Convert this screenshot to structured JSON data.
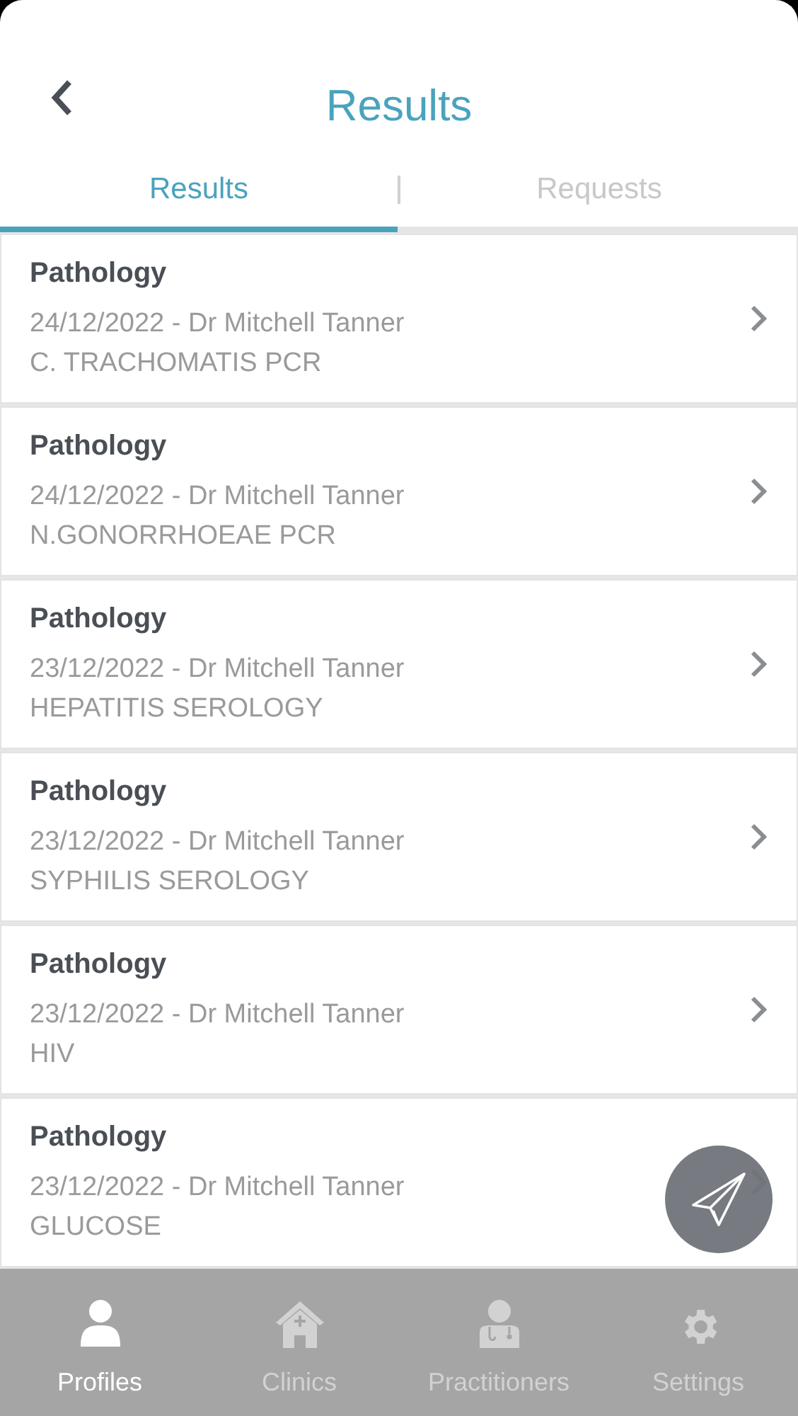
{
  "header": {
    "title": "Results"
  },
  "tabs": [
    {
      "label": "Results",
      "selected": true
    },
    {
      "label": "Requests",
      "selected": false
    }
  ],
  "results": [
    {
      "category": "Pathology",
      "date_doctor": "24/12/2022 - Dr Mitchell Tanner",
      "test": "C. TRACHOMATIS PCR"
    },
    {
      "category": "Pathology",
      "date_doctor": "24/12/2022 - Dr Mitchell Tanner",
      "test": "N.GONORRHOEAE PCR"
    },
    {
      "category": "Pathology",
      "date_doctor": "23/12/2022 - Dr Mitchell Tanner",
      "test": "HEPATITIS SEROLOGY"
    },
    {
      "category": "Pathology",
      "date_doctor": "23/12/2022 - Dr Mitchell Tanner",
      "test": "SYPHILIS SEROLOGY"
    },
    {
      "category": "Pathology",
      "date_doctor": "23/12/2022 - Dr Mitchell Tanner",
      "test": "HIV"
    },
    {
      "category": "Pathology",
      "date_doctor": "23/12/2022 - Dr Mitchell Tanner",
      "test": "GLUCOSE"
    }
  ],
  "nav": [
    {
      "label": "Profiles",
      "selected": true
    },
    {
      "label": "Clinics",
      "selected": false
    },
    {
      "label": "Practitioners",
      "selected": false
    },
    {
      "label": "Settings",
      "selected": false
    }
  ]
}
